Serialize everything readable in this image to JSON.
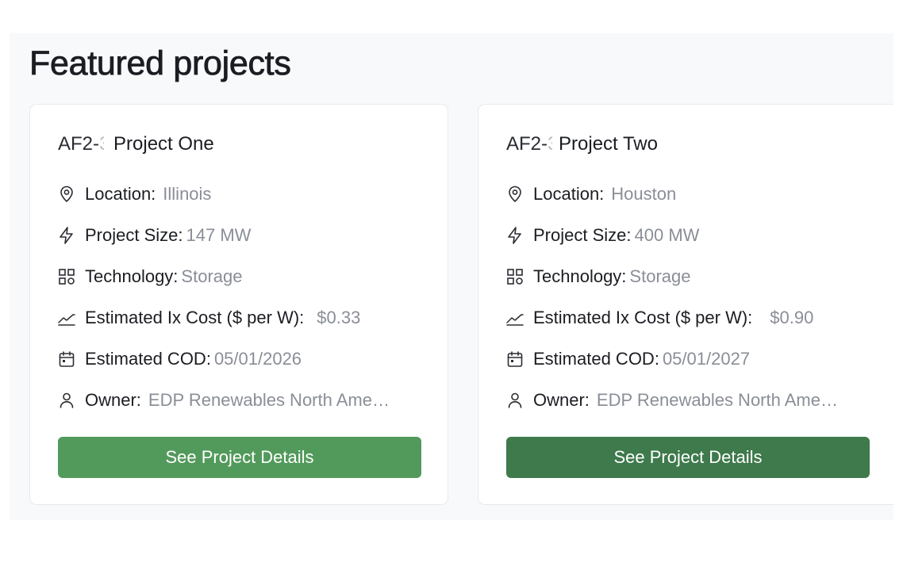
{
  "section": {
    "title": "Featured projects"
  },
  "labels": {
    "location": "Location:",
    "size": "Project Size:",
    "technology": "Technology:",
    "cost": "Estimated Ix Cost ($ per W):",
    "cod": "Estimated COD:",
    "owner": "Owner:"
  },
  "projects": [
    {
      "code": "AF2-",
      "name": "Project One",
      "location": "Illinois",
      "size": "147 MW",
      "technology": "Storage",
      "cost": "$0.33",
      "cod": "05/01/2026",
      "owner": "EDP Renewables North America LLC",
      "button_label": "See Project Details"
    },
    {
      "code": "AF2-",
      "name": "Project Two",
      "location": "Houston",
      "size": "400 MW",
      "technology": "Storage",
      "cost": "$0.90",
      "cod": "05/01/2027",
      "owner": "EDP Renewables North America LLC",
      "button_label": "See Project Details"
    }
  ],
  "colors": {
    "button_primary": "#529a5b",
    "button_hover": "#3e7a4c",
    "value_text": "#8a8e97"
  },
  "icons": [
    "map-pin-icon",
    "lightning-icon",
    "grid-icon",
    "trend-icon",
    "calendar-icon",
    "user-icon"
  ]
}
